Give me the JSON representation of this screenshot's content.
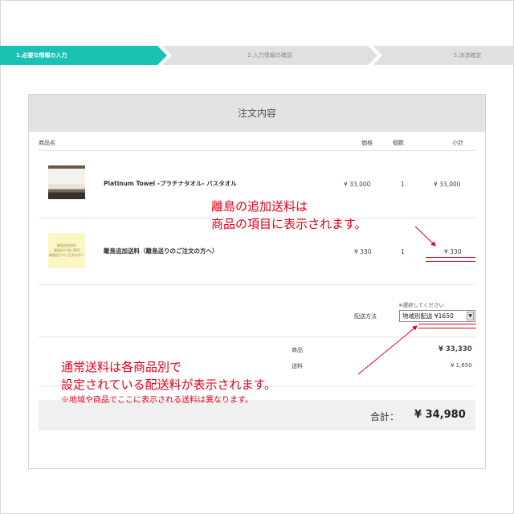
{
  "steps": [
    {
      "label": "1.必要な情報の入力"
    },
    {
      "label": "2.入力情報の確認"
    },
    {
      "label": "3.決済確定"
    }
  ],
  "panel": {
    "title": "注文内容"
  },
  "table": {
    "headers": {
      "product": "商品名",
      "price": "価格",
      "qty": "個数",
      "subtotal": "小計"
    },
    "rows": [
      {
        "name": "Platinum Towel -プラチナタオル- バスタオル",
        "price": "¥ 33,000",
        "qty": "1",
        "subtotal": "¥ 33,000"
      },
      {
        "name": "離島追加送料（離島送りのご注文の方へ）",
        "price": "¥ 330",
        "qty": "1",
        "subtotal": "¥ 330"
      }
    ]
  },
  "island_thumb": {
    "line1": "離島追加送料",
    "line2": "離島送り用に適用",
    "line3": "離島送りのご注文の方へ"
  },
  "shipping": {
    "hint": "※選択してください",
    "label": "配送方法",
    "selected": "地域別配送 ¥1650"
  },
  "summary": {
    "goods_label": "商品",
    "goods_value": "¥ 33,330",
    "shipping_label": "送料",
    "shipping_value": "¥ 1,650"
  },
  "total": {
    "label": "合計：",
    "value": "¥ 34,980"
  },
  "annotations": {
    "island_line1": "離島の追加送料は",
    "island_line2": "商品の項目に表示されます。",
    "normal_line1": "通常送料は各商品別で",
    "normal_line2": "設定されている配送料が表示されます。",
    "note": "※地域や商品でここに表示される送料は異なります。"
  },
  "colors": {
    "accent": "#19c2b5",
    "annotation": "#e3001b"
  }
}
